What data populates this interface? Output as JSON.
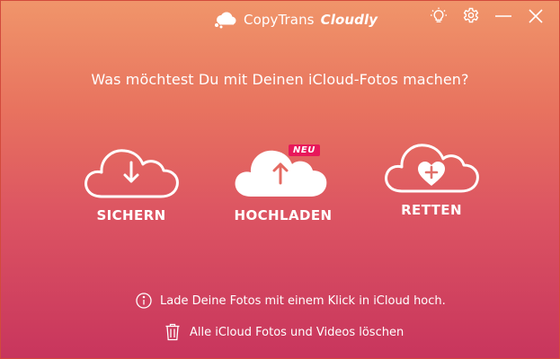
{
  "window": {
    "app_name": "CopyTrans",
    "app_brand": "Cloudly"
  },
  "title_icons": [
    "lightbulb-icon",
    "gear-icon",
    "minimize-icon",
    "close-icon"
  ],
  "main": {
    "question": "Was möchtest Du mit Deinen iCloud-Fotos machen?",
    "actions": [
      {
        "id": "sichern",
        "label": "SICHERN",
        "icon": "cloud-download-icon"
      },
      {
        "id": "hochladen",
        "label": "HOCHLADEN",
        "icon": "cloud-upload-icon",
        "badge": "NEU"
      },
      {
        "id": "retten",
        "label": "RETTEN",
        "icon": "cloud-heart-icon"
      }
    ]
  },
  "footer": {
    "info_text": "Lade Deine Fotos mit einem Klick in iCloud hoch.",
    "delete_text": "Alle iCloud Fotos und Videos löschen"
  },
  "colors": {
    "gradient_top": "#f0956a",
    "gradient_bottom": "#c8355d",
    "badge": "#e8185a",
    "text": "#ffffff"
  }
}
